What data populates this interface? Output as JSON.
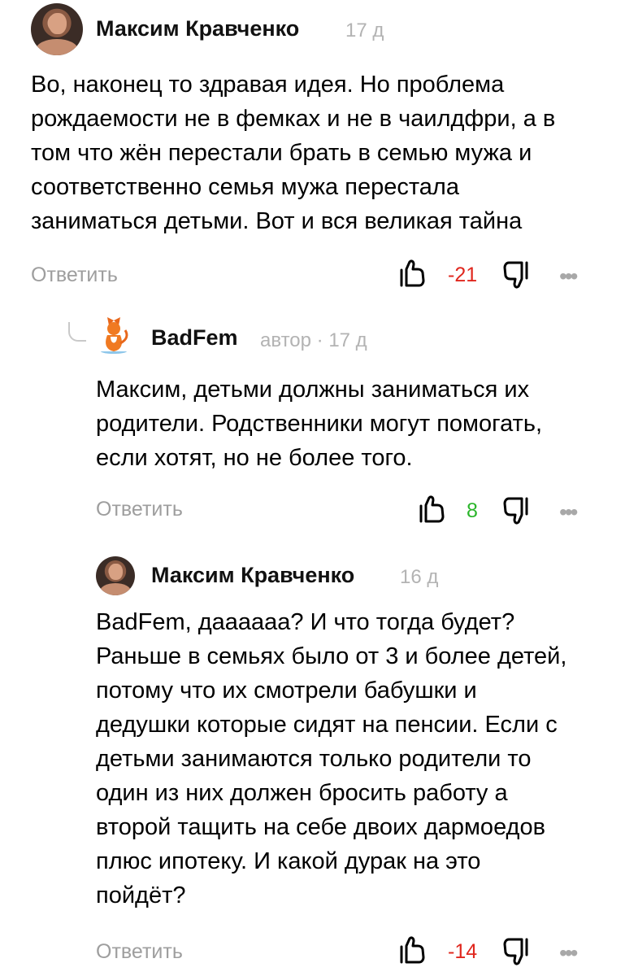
{
  "comments": [
    {
      "author": "Максим Кравченко",
      "meta": "17 д",
      "text": "Во, наконец то здравая идея. Но проблема\nрождаемости не в фемках и не в чаилдфри, а в\nтом что жён перестали брать в семью мужа и\nсоответственно семья мужа перестала\nзаниматься детьми. Вот и вся великая тайна",
      "reply_label": "Ответить",
      "score": "-21",
      "score_color": "#e0271e",
      "avatar_icon": "user-photo"
    },
    {
      "author": "BadFem",
      "meta": "автор · 17 д",
      "text": "Максим, детьми должны заниматься их\nродители. Родственники могут помогать,\nесли хотят, но не более того.",
      "reply_label": "Ответить",
      "score": "8",
      "score_color": "#2bb52b",
      "avatar_icon": "fox-logo"
    },
    {
      "author": "Максим Кравченко",
      "meta": "16 д",
      "text": "BadFem, даааааа? И что тогда будет?\nРаньше в семьях было от 3 и более детей,\nпотому что их смотрели бабушки и\nдедушки которые сидят на пенсии. Если с\nдетьми занимаются только родители то\nодин из них должен бросить работу а\nвторой тащить на себе двоих дармоедов\nплюс ипотеку. И какой дурак на это\nпойдёт?",
      "reply_label": "Ответить",
      "score": "-14",
      "score_color": "#e0271e",
      "avatar_icon": "user-photo"
    }
  ],
  "icons": {
    "like": "thumbs-up-icon",
    "dislike": "thumbs-down-icon",
    "more": "more-dots-icon",
    "thread": "reply-thread-icon"
  }
}
